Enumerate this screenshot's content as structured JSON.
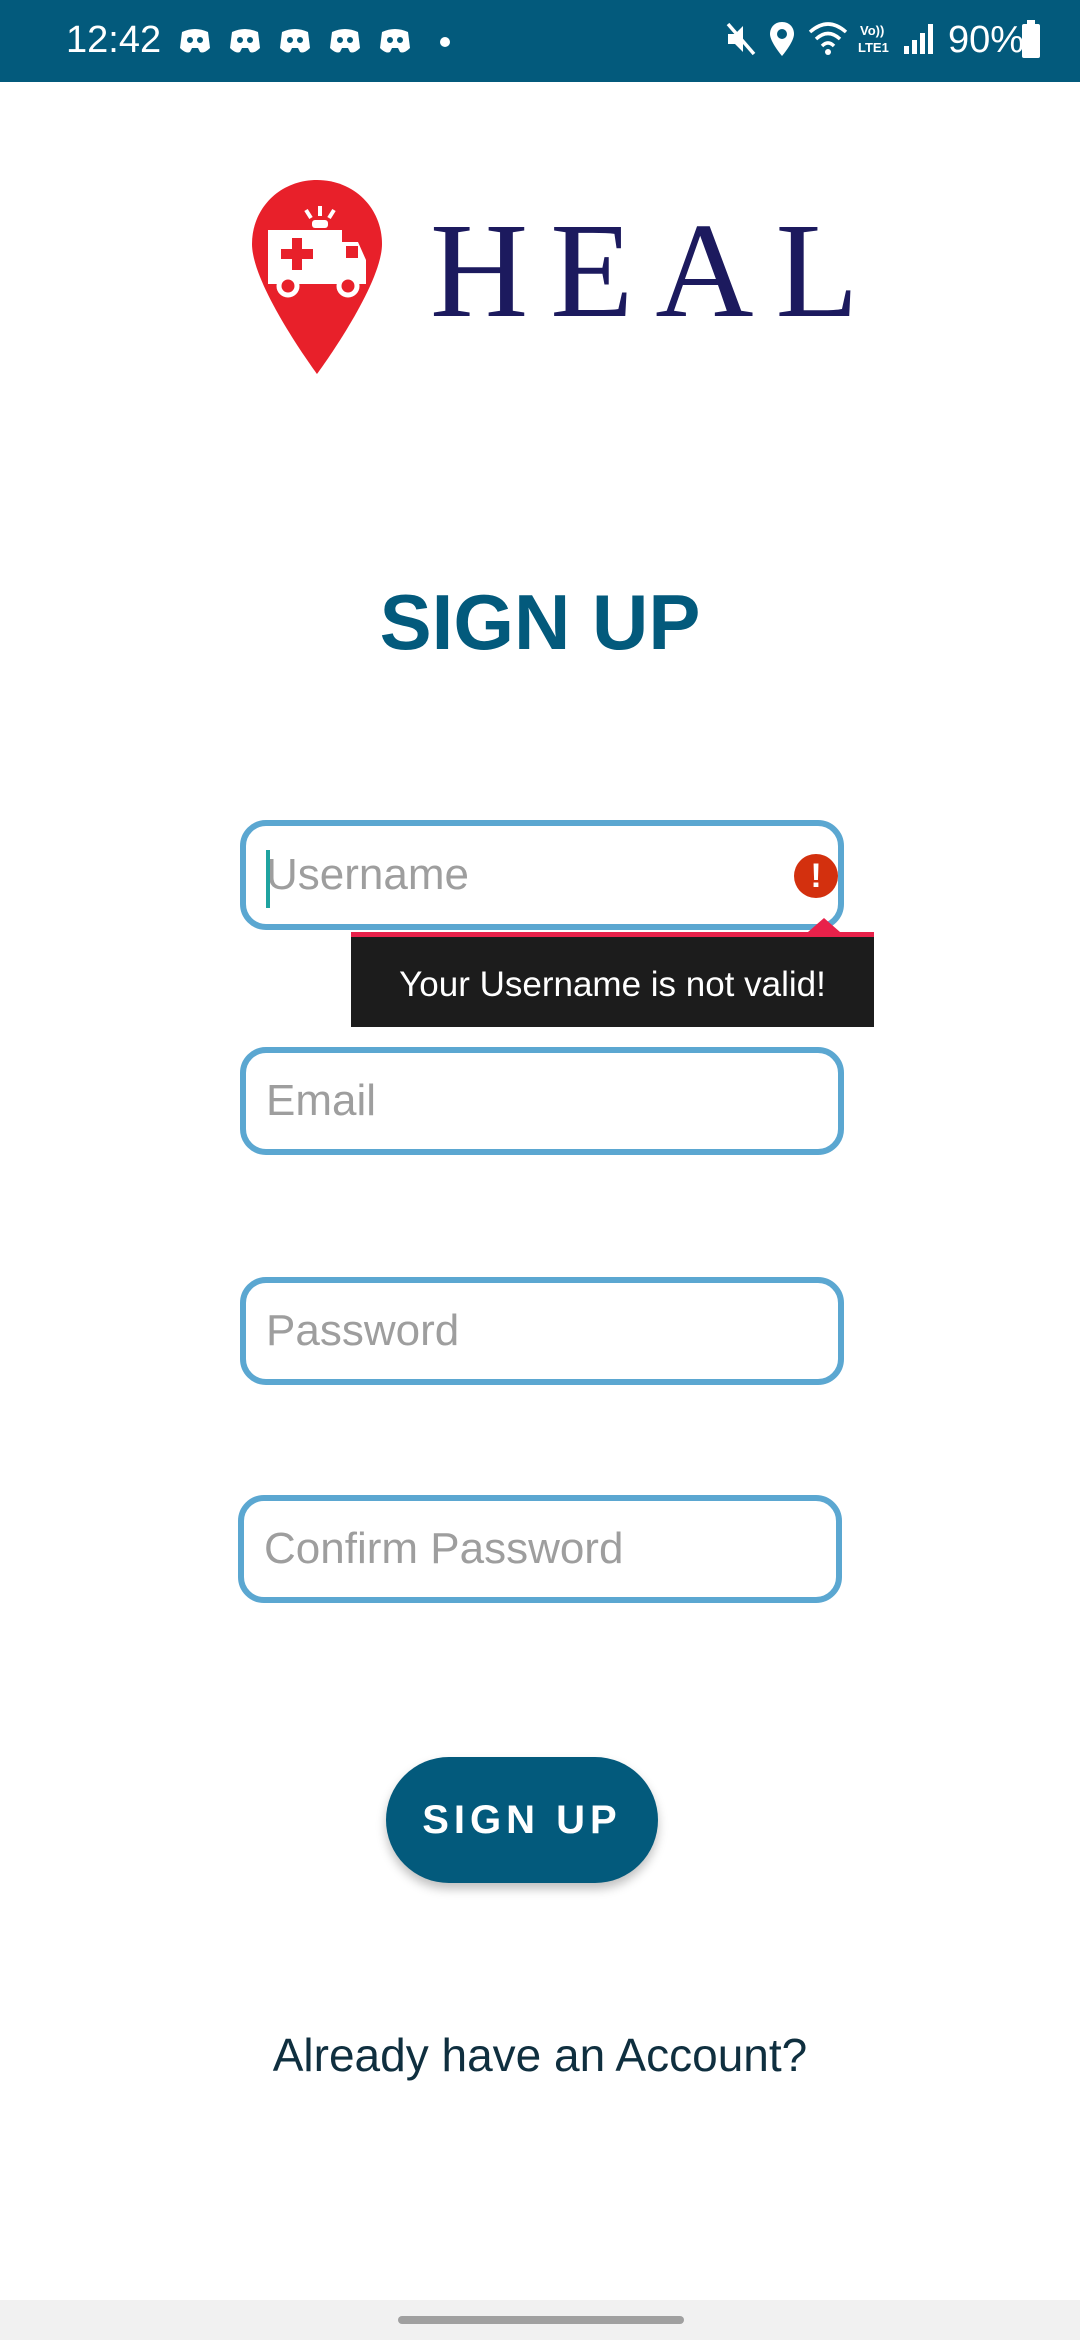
{
  "status_bar": {
    "time": "12:42",
    "notification_icons": [
      "discord-icon",
      "discord-icon",
      "discord-icon",
      "discord-icon",
      "discord-icon"
    ],
    "right_icons": [
      "mute-icon",
      "location-icon",
      "wifi-icon",
      "volte-lte-icon",
      "signal-icon"
    ],
    "volte_label": "Vo)) LTE1",
    "battery_percent": "90%"
  },
  "logo": {
    "icon": "ambulance-pin-icon",
    "text": "HEAL",
    "pin_color": "#e8202a",
    "text_color": "#1c1a5e"
  },
  "page_title": "SIGN UP",
  "form": {
    "username": {
      "placeholder": "Username",
      "value": "",
      "error": "Your Username is not valid!"
    },
    "email": {
      "placeholder": "Email",
      "value": ""
    },
    "password": {
      "placeholder": "Password",
      "value": ""
    },
    "confirm_password": {
      "placeholder": "Confirm Password",
      "value": ""
    }
  },
  "signup_button_label": "SIGN UP",
  "already_account_link": "Already have an Account?",
  "colors": {
    "primary": "#035a7c",
    "field_border": "#5ba7d1",
    "error": "#d3300e"
  }
}
